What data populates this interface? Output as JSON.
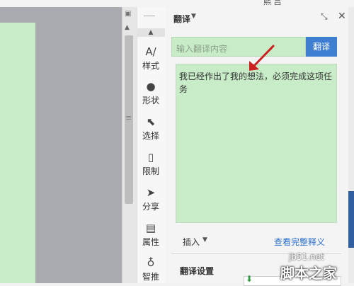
{
  "topbar": {
    "fragment": "熙 吕"
  },
  "toolpanel": {
    "items": [
      {
        "label": "样式",
        "icon": "style-icon",
        "glyph": "A/"
      },
      {
        "label": "形状",
        "icon": "shape-icon",
        "glyph": "●"
      },
      {
        "label": "选择",
        "icon": "select-icon",
        "glyph": "⬉"
      },
      {
        "label": "限制",
        "icon": "restrict-icon",
        "glyph": "▯"
      },
      {
        "label": "分享",
        "icon": "share-icon",
        "glyph": "➤"
      },
      {
        "label": "属性",
        "icon": "properties-icon",
        "glyph": "▤"
      },
      {
        "label": "智推",
        "icon": "smart-icon",
        "glyph": "♁"
      }
    ]
  },
  "panel": {
    "title": "翻译",
    "input_placeholder": "输入翻译内容",
    "translate_button": "翻译",
    "output_text": "我已经作出了我的想法，必须完成这项任务",
    "insert_label": "插入",
    "view_full_label": "查看完整释义",
    "settings_title": "翻译设置"
  },
  "watermark": {
    "site": "jb51.net",
    "name": "脚本之家"
  },
  "colors": {
    "accent": "#3f7fd1",
    "green_bg": "#c8ecc8",
    "arrow": "#cc1f1f"
  }
}
